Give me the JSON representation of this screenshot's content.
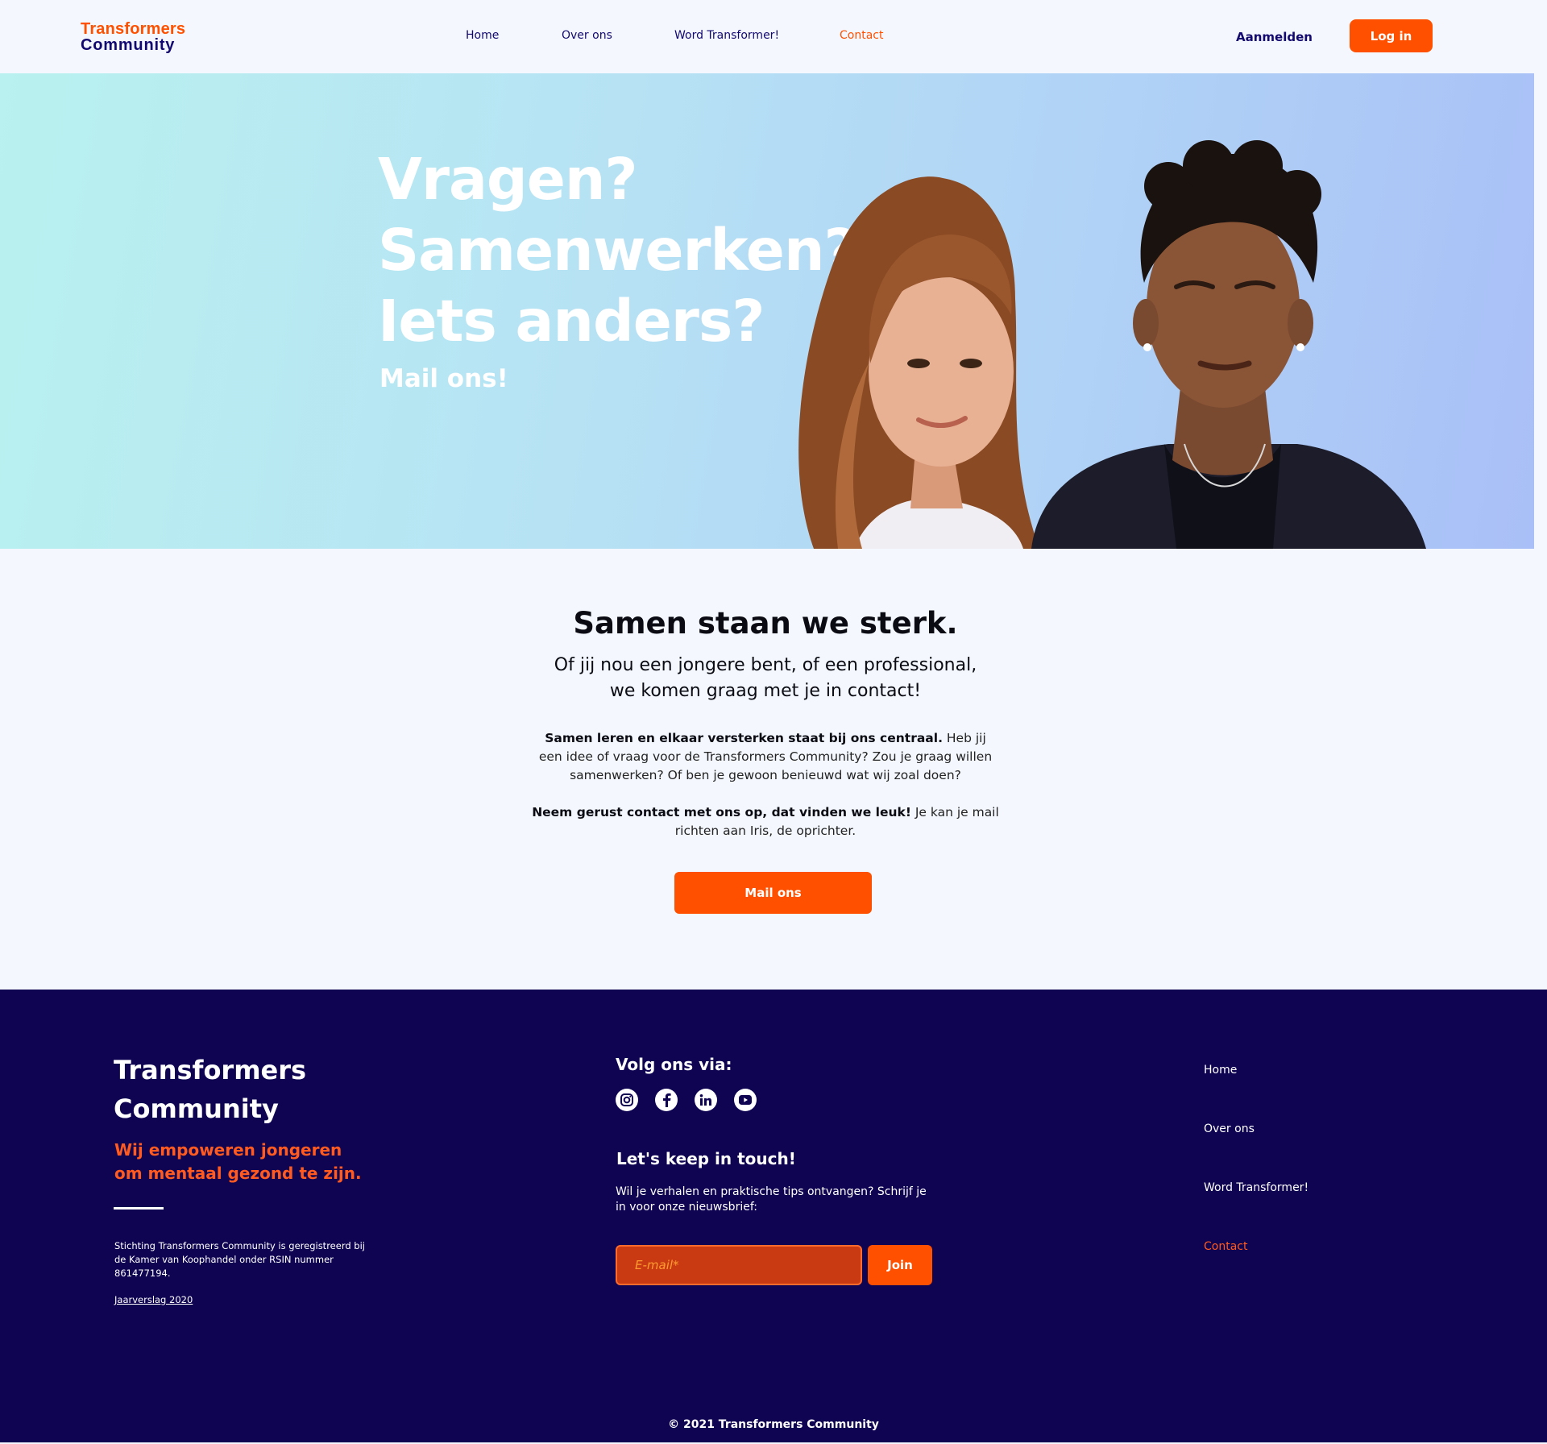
{
  "header": {
    "logo_line1": "Transformers",
    "logo_line2": "Community",
    "nav": [
      "Home",
      "Over ons",
      "Word Transformer!",
      "Contact"
    ],
    "active_nav": "Contact",
    "signup_label": "Aanmelden",
    "login_label": "Log in"
  },
  "hero": {
    "heading": [
      "Vragen?",
      "Samenwerken?",
      "Iets anders?"
    ],
    "sub": "Mail ons!"
  },
  "main": {
    "title": "Samen staan we sterk.",
    "subtitle": [
      "Of jij nou een jongere bent, of een professional,",
      "we komen graag met je in contact!"
    ],
    "para1_bold": "Samen leren en elkaar versterken staat bij ons centraal.",
    "para1_text": " Heb jij een idee of vraag voor de Transformers Community? Zou je graag willen samenwerken? Of ben je gewoon benieuwd wat wij zoal doen?",
    "para2_bold": "Neem gerust contact met ons op, dat vinden we leuk!",
    "para2_text": " Je kan je mail richten aan Iris, de oprichter.",
    "mail_button": "Mail ons"
  },
  "footer": {
    "brand": [
      "Transformers",
      "Community"
    ],
    "tagline": [
      "Wij empoweren jongeren",
      "om mentaal gezond te zijn."
    ],
    "legal": "Stichting Transformers Community is geregistreerd bij de Kamer van Koophandel onder RSIN nummer 861477194.",
    "report_link": "Jaarverslag 2020",
    "follow_label": "Volg ons via:",
    "socials": [
      "instagram-icon",
      "facebook-icon",
      "linkedin-icon",
      "youtube-icon"
    ],
    "keep_in_touch": "Let's keep in touch!",
    "newsletter_text": "Wil je verhalen en praktische tips ontvangen? Schrijf je in voor onze nieuwsbrief:",
    "email_placeholder": "E-mail*",
    "join_label": "Join",
    "nav": [
      "Home",
      "Over ons",
      "Word Transformer!",
      "Contact"
    ],
    "copyright": "© 2021 Transformers Community"
  },
  "colors": {
    "accent": "#ff5000",
    "navy": "#12086f",
    "footer_bg": "#0f0452"
  }
}
